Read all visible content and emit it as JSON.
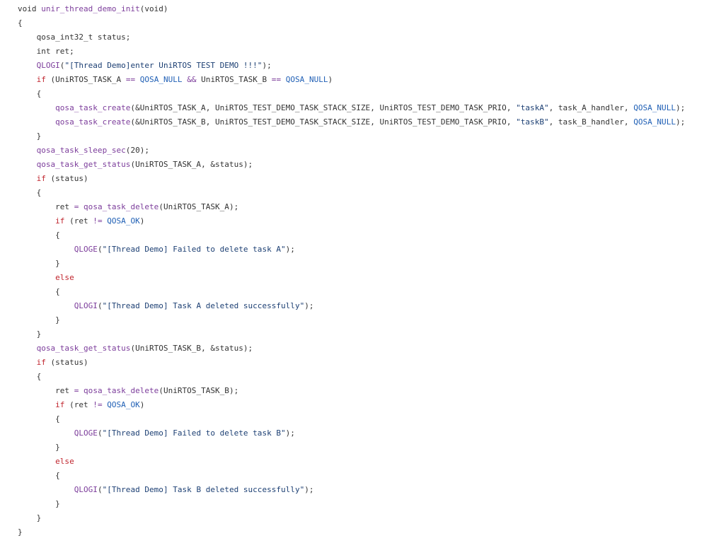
{
  "colors": {
    "background": "#ffffff",
    "plain": "#333333",
    "keyword": "#c0252e",
    "function": "#7c3d9b",
    "constant": "#1f5fb5",
    "string": "#1c3f73"
  },
  "code": {
    "language": "c",
    "lines": [
      [
        [
          "plain",
          "void "
        ],
        [
          "function",
          "unir_thread_demo_init"
        ],
        [
          "plain",
          "(void)"
        ]
      ],
      [
        [
          "plain",
          "{"
        ]
      ],
      [
        [
          "plain",
          "    qosa_int32_t status;"
        ]
      ],
      [
        [
          "plain",
          "    int ret;"
        ]
      ],
      [
        [
          "plain",
          "    "
        ],
        [
          "function",
          "QLOGI"
        ],
        [
          "plain",
          "("
        ],
        [
          "string",
          "\"[Thread Demo]enter UniRTOS TEST DEMO !!!\""
        ],
        [
          "plain",
          ");"
        ]
      ],
      [
        [
          "plain",
          "    "
        ],
        [
          "keyword",
          "if"
        ],
        [
          "plain",
          " (UniRTOS_TASK_A "
        ],
        [
          "function",
          "=="
        ],
        [
          "plain",
          " "
        ],
        [
          "constant",
          "QOSA_NULL"
        ],
        [
          "plain",
          " "
        ],
        [
          "function",
          "&&"
        ],
        [
          "plain",
          " UniRTOS_TASK_B "
        ],
        [
          "function",
          "=="
        ],
        [
          "plain",
          " "
        ],
        [
          "constant",
          "QOSA_NULL"
        ],
        [
          "plain",
          ")"
        ]
      ],
      [
        [
          "plain",
          "    {"
        ]
      ],
      [
        [
          "plain",
          "        "
        ],
        [
          "function",
          "qosa_task_create"
        ],
        [
          "plain",
          "(&UniRTOS_TASK_A, UniRTOS_TEST_DEMO_TASK_STACK_SIZE, UniRTOS_TEST_DEMO_TASK_PRIO, "
        ],
        [
          "string",
          "\"taskA\""
        ],
        [
          "plain",
          ", task_A_handler, "
        ],
        [
          "constant",
          "QOSA_NULL"
        ],
        [
          "plain",
          ");"
        ]
      ],
      [
        [
          "plain",
          "        "
        ],
        [
          "function",
          "qosa_task_create"
        ],
        [
          "plain",
          "(&UniRTOS_TASK_B, UniRTOS_TEST_DEMO_TASK_STACK_SIZE, UniRTOS_TEST_DEMO_TASK_PRIO, "
        ],
        [
          "string",
          "\"taskB\""
        ],
        [
          "plain",
          ", task_B_handler, "
        ],
        [
          "constant",
          "QOSA_NULL"
        ],
        [
          "plain",
          ");"
        ]
      ],
      [
        [
          "plain",
          "    }"
        ]
      ],
      [
        [
          "plain",
          "    "
        ],
        [
          "function",
          "qosa_task_sleep_sec"
        ],
        [
          "plain",
          "(20);"
        ]
      ],
      [
        [
          "plain",
          "    "
        ],
        [
          "function",
          "qosa_task_get_status"
        ],
        [
          "plain",
          "(UniRTOS_TASK_A, &status);"
        ]
      ],
      [
        [
          "plain",
          "    "
        ],
        [
          "keyword",
          "if"
        ],
        [
          "plain",
          " (status)"
        ]
      ],
      [
        [
          "plain",
          "    {"
        ]
      ],
      [
        [
          "plain",
          "        ret "
        ],
        [
          "function",
          "="
        ],
        [
          "plain",
          " "
        ],
        [
          "function",
          "qosa_task_delete"
        ],
        [
          "plain",
          "(UniRTOS_TASK_A);"
        ]
      ],
      [
        [
          "plain",
          "        "
        ],
        [
          "keyword",
          "if"
        ],
        [
          "plain",
          " (ret "
        ],
        [
          "function",
          "!="
        ],
        [
          "plain",
          " "
        ],
        [
          "constant",
          "QOSA_OK"
        ],
        [
          "plain",
          ")"
        ]
      ],
      [
        [
          "plain",
          "        {"
        ]
      ],
      [
        [
          "plain",
          "            "
        ],
        [
          "function",
          "QLOGE"
        ],
        [
          "plain",
          "("
        ],
        [
          "string",
          "\"[Thread Demo] Failed to delete task A\""
        ],
        [
          "plain",
          ");"
        ]
      ],
      [
        [
          "plain",
          "        }"
        ]
      ],
      [
        [
          "plain",
          "        "
        ],
        [
          "keyword",
          "else"
        ]
      ],
      [
        [
          "plain",
          "        {"
        ]
      ],
      [
        [
          "plain",
          "            "
        ],
        [
          "function",
          "QLOGI"
        ],
        [
          "plain",
          "("
        ],
        [
          "string",
          "\"[Thread Demo] Task A deleted successfully\""
        ],
        [
          "plain",
          ");"
        ]
      ],
      [
        [
          "plain",
          "        }"
        ]
      ],
      [
        [
          "plain",
          "    }"
        ]
      ],
      [
        [
          "plain",
          "    "
        ],
        [
          "function",
          "qosa_task_get_status"
        ],
        [
          "plain",
          "(UniRTOS_TASK_B, &status);"
        ]
      ],
      [
        [
          "plain",
          "    "
        ],
        [
          "keyword",
          "if"
        ],
        [
          "plain",
          " (status)"
        ]
      ],
      [
        [
          "plain",
          "    {"
        ]
      ],
      [
        [
          "plain",
          "        ret "
        ],
        [
          "function",
          "="
        ],
        [
          "plain",
          " "
        ],
        [
          "function",
          "qosa_task_delete"
        ],
        [
          "plain",
          "(UniRTOS_TASK_B);"
        ]
      ],
      [
        [
          "plain",
          "        "
        ],
        [
          "keyword",
          "if"
        ],
        [
          "plain",
          " (ret "
        ],
        [
          "function",
          "!="
        ],
        [
          "plain",
          " "
        ],
        [
          "constant",
          "QOSA_OK"
        ],
        [
          "plain",
          ")"
        ]
      ],
      [
        [
          "plain",
          "        {"
        ]
      ],
      [
        [
          "plain",
          "            "
        ],
        [
          "function",
          "QLOGE"
        ],
        [
          "plain",
          "("
        ],
        [
          "string",
          "\"[Thread Demo] Failed to delete task B\""
        ],
        [
          "plain",
          ");"
        ]
      ],
      [
        [
          "plain",
          "        }"
        ]
      ],
      [
        [
          "plain",
          "        "
        ],
        [
          "keyword",
          "else"
        ]
      ],
      [
        [
          "plain",
          "        {"
        ]
      ],
      [
        [
          "plain",
          "            "
        ],
        [
          "function",
          "QLOGI"
        ],
        [
          "plain",
          "("
        ],
        [
          "string",
          "\"[Thread Demo] Task B deleted successfully\""
        ],
        [
          "plain",
          ");"
        ]
      ],
      [
        [
          "plain",
          "        }"
        ]
      ],
      [
        [
          "plain",
          "    }"
        ]
      ],
      [
        [
          "plain",
          "}"
        ]
      ]
    ]
  }
}
